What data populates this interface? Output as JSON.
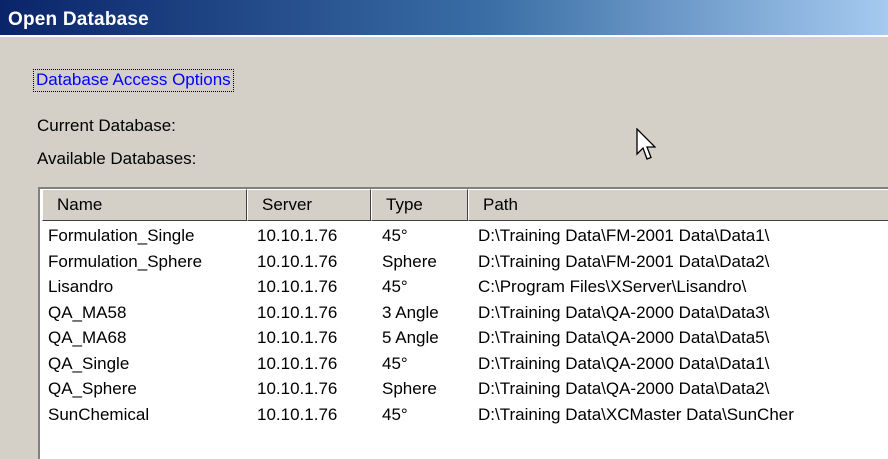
{
  "window": {
    "title": "Open Database"
  },
  "options_link": "Database Access Options",
  "current_database_label": "Current Database:",
  "available_databases_label": "Available Databases:",
  "table": {
    "columns": [
      "Name",
      "Server",
      "Type",
      "Path"
    ],
    "rows": [
      {
        "name": "Formulation_Single",
        "server": "10.10.1.76",
        "type": "45°",
        "path": "D:\\Training Data\\FM-2001 Data\\Data1\\"
      },
      {
        "name": "Formulation_Sphere",
        "server": "10.10.1.76",
        "type": "Sphere",
        "path": "D:\\Training Data\\FM-2001 Data\\Data2\\"
      },
      {
        "name": "Lisandro",
        "server": "10.10.1.76",
        "type": "45°",
        "path": "C:\\Program Files\\XServer\\Lisandro\\"
      },
      {
        "name": "QA_MA58",
        "server": "10.10.1.76",
        "type": "3 Angle",
        "path": "D:\\Training Data\\QA-2000 Data\\Data3\\"
      },
      {
        "name": "QA_MA68",
        "server": "10.10.1.76",
        "type": "5 Angle",
        "path": "D:\\Training Data\\QA-2000 Data\\Data5\\"
      },
      {
        "name": "QA_Single",
        "server": "10.10.1.76",
        "type": "45°",
        "path": "D:\\Training Data\\QA-2000 Data\\Data1\\"
      },
      {
        "name": "QA_Sphere",
        "server": "10.10.1.76",
        "type": "Sphere",
        "path": "D:\\Training Data\\QA-2000 Data\\Data2\\"
      },
      {
        "name": "SunChemical",
        "server": "10.10.1.76",
        "type": "45°",
        "path": "D:\\Training Data\\XCMaster Data\\SunCher"
      }
    ]
  },
  "colors": {
    "title_gradient_start": "#0a246a",
    "title_gradient_end": "#a6caf0",
    "link": "#0000ff",
    "dialog_background": "#d4d0c8"
  },
  "icons": {
    "cursor": "mouse-pointer-arrow"
  }
}
